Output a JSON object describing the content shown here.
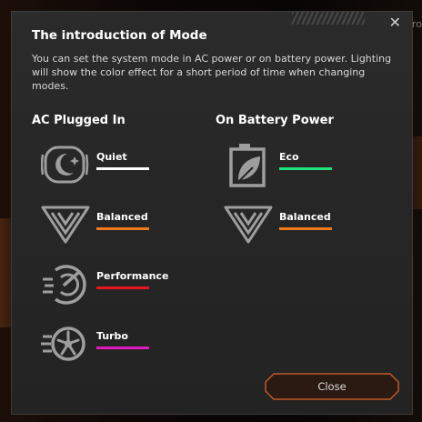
{
  "background": {
    "tab_label": "Turbo Gro"
  },
  "dialog": {
    "title": "The introduction of Mode",
    "description": "You can set the system mode in AC power or on battery power. Lighting will show the color effect for a short period of time when changing modes.",
    "close_x": "✕",
    "close_button": "Close"
  },
  "columns": {
    "ac": {
      "heading": "AC Plugged In",
      "modes": [
        {
          "label": "Quiet",
          "icon": "quiet-mode-icon",
          "color": "#ffffff"
        },
        {
          "label": "Balanced",
          "icon": "balanced-mode-icon",
          "color": "#f07a1a"
        },
        {
          "label": "Performance",
          "icon": "performance-mode-icon",
          "color": "#e8141e"
        },
        {
          "label": "Turbo",
          "icon": "turbo-mode-icon",
          "color": "#e019c0"
        }
      ]
    },
    "battery": {
      "heading": "On Battery Power",
      "modes": [
        {
          "label": "Eco",
          "icon": "eco-mode-icon",
          "color": "#22e07a"
        },
        {
          "label": "Balanced",
          "icon": "balanced-mode-icon",
          "color": "#f07a1a"
        }
      ]
    }
  }
}
